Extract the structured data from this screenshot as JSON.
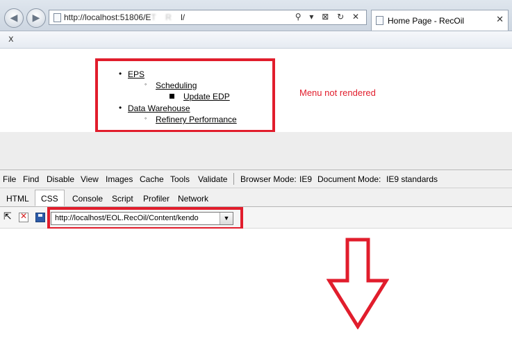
{
  "browser": {
    "address": "http://localhost:51806/E",
    "address_blur": "T    R    ",
    "address_tail": "l/",
    "address_tools": "⚲ ▾ ⊠ ↻ ✕",
    "tab_title": "Home Page - RecOil",
    "tab_close": "✕",
    "cmdbar_close": "x"
  },
  "menu": {
    "items": [
      {
        "label": "EPS",
        "children": [
          {
            "label": "Scheduling",
            "children": [
              {
                "label": "Update EDP"
              }
            ]
          }
        ]
      },
      {
        "label": "Data Warehouse",
        "children": [
          {
            "label": "Refinery Performance"
          }
        ]
      }
    ]
  },
  "annotations": {
    "note": "Menu not rendered",
    "accent": "#e11d2c"
  },
  "devtools": {
    "menu": [
      "File",
      "Find",
      "Disable",
      "View",
      "Images",
      "Cache",
      "Tools",
      "Validate"
    ],
    "browser_mode_label": "Browser Mode:",
    "browser_mode_value": "IE9",
    "document_mode_label": "Document Mode:",
    "document_mode_value": "IE9 standards",
    "tabs": [
      "HTML",
      "CSS",
      "Console",
      "Script",
      "Profiler",
      "Network"
    ],
    "active_tab": "CSS",
    "stylesheet_selected": "http://localhost/EOL.RecOil/Content/kendo"
  }
}
